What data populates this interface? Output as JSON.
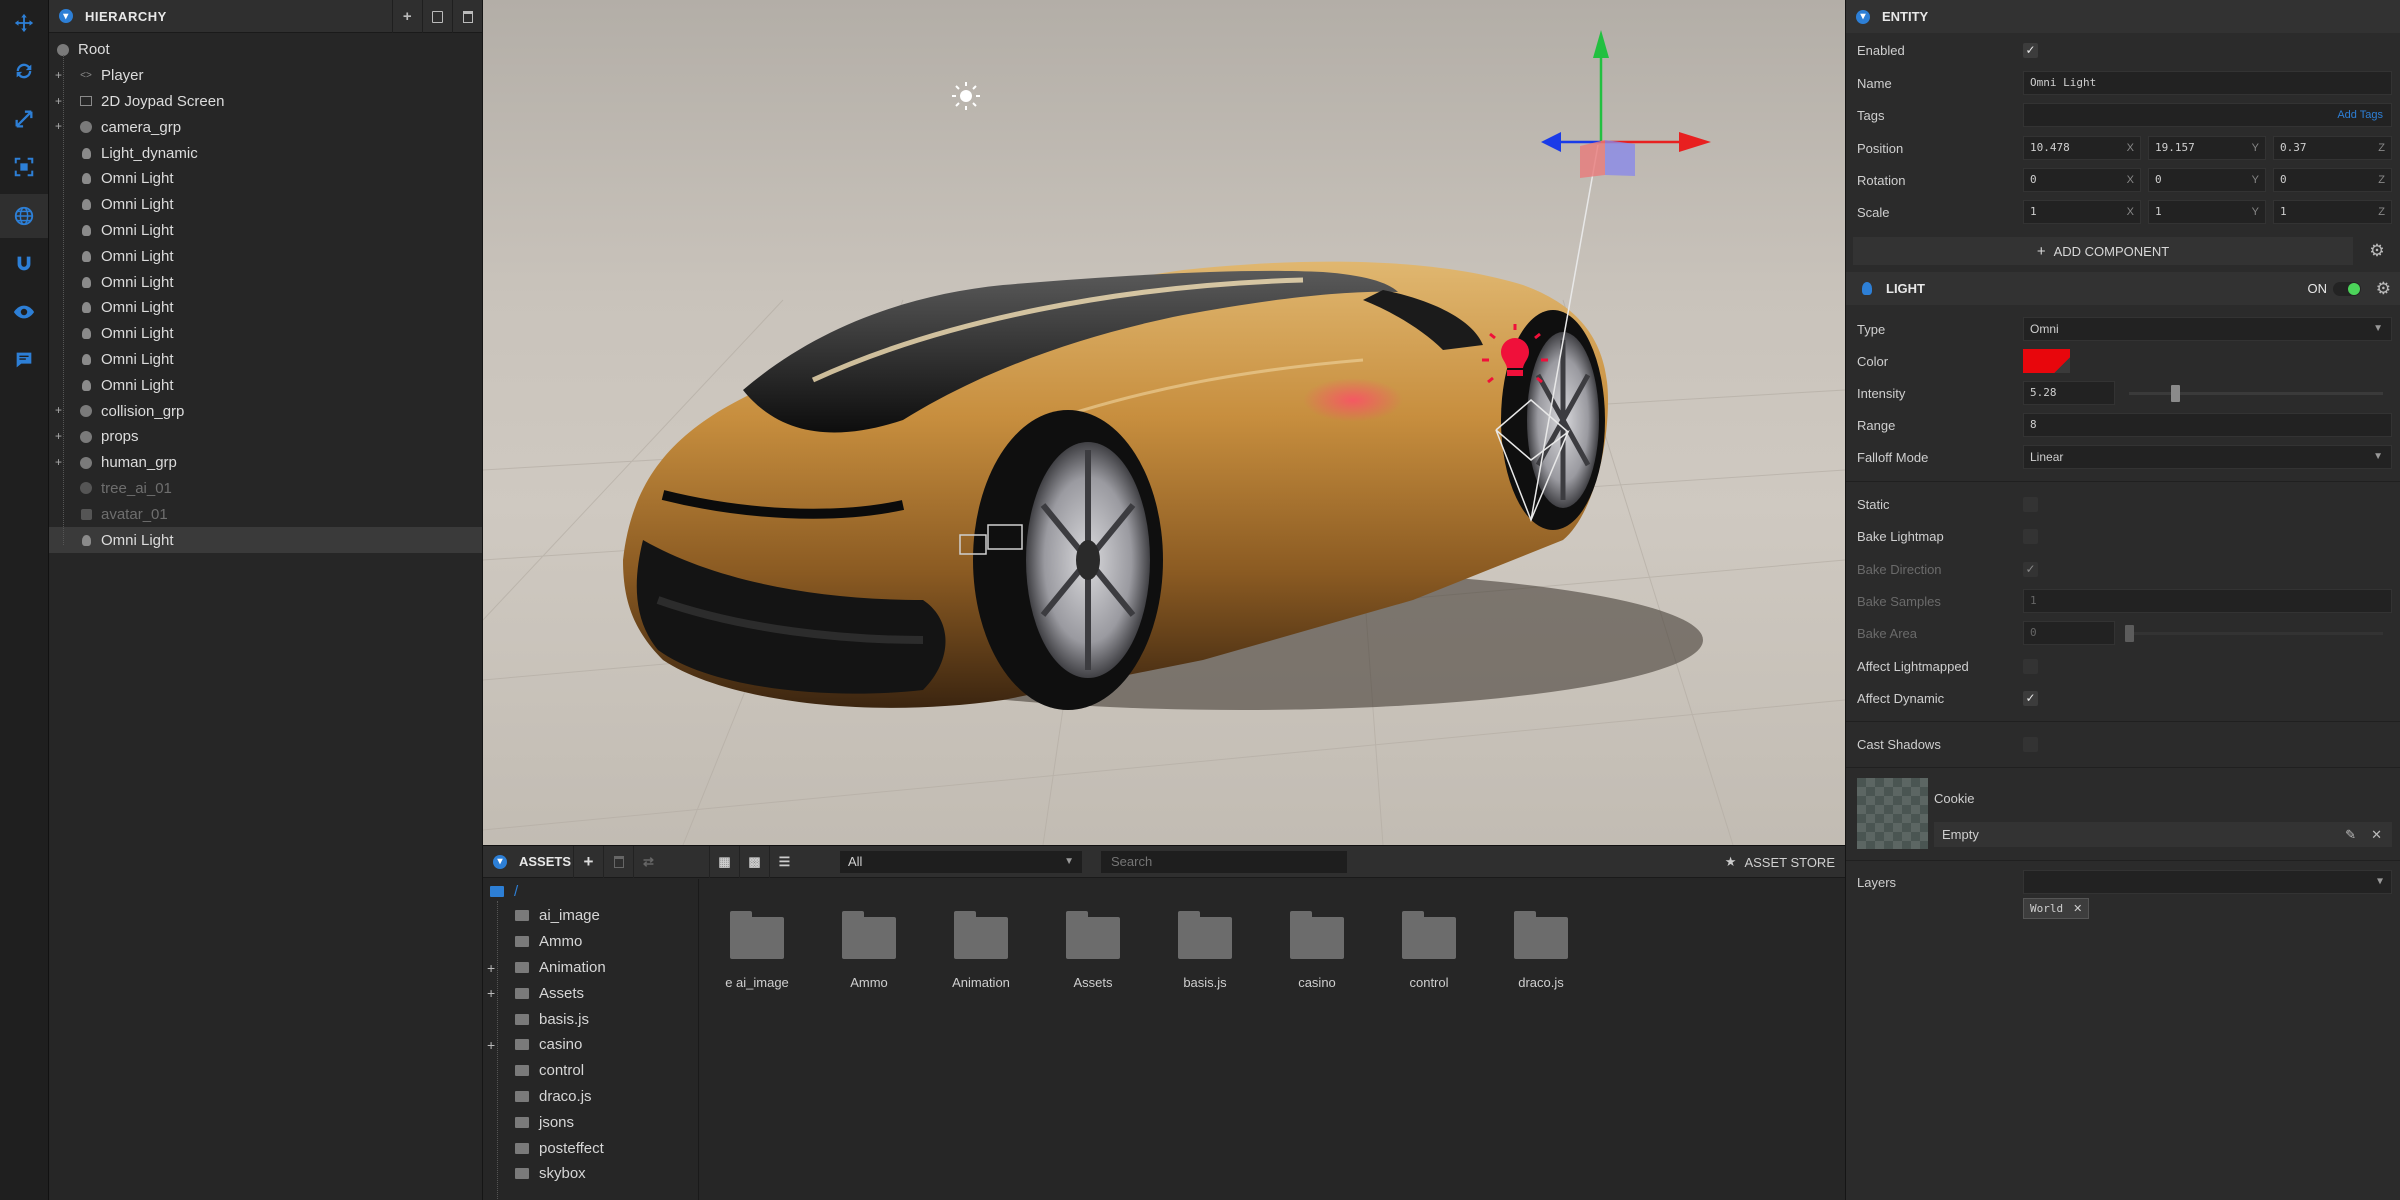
{
  "toolbar": {
    "tools": [
      "move-icon",
      "rotate-icon",
      "scale-icon",
      "resize-icon",
      "world-icon",
      "snap-icon",
      "view-icon",
      "chat-icon"
    ]
  },
  "hierarchy": {
    "title": "HIERARCHY",
    "items": [
      {
        "label": "Root",
        "icon": "circle",
        "depth": 0,
        "expand": false
      },
      {
        "label": "Player",
        "icon": "code",
        "depth": 1,
        "expand": true
      },
      {
        "label": "2D Joypad Screen",
        "icon": "screen",
        "depth": 1,
        "expand": true
      },
      {
        "label": "camera_grp",
        "icon": "circle",
        "depth": 1,
        "expand": true
      },
      {
        "label": "Light_dynamic",
        "icon": "bulb",
        "depth": 1,
        "expand": false
      },
      {
        "label": "Omni Light",
        "icon": "bulb",
        "depth": 1,
        "expand": false
      },
      {
        "label": "Omni Light",
        "icon": "bulb",
        "depth": 1,
        "expand": false
      },
      {
        "label": "Omni Light",
        "icon": "bulb",
        "depth": 1,
        "expand": false
      },
      {
        "label": "Omni Light",
        "icon": "bulb",
        "depth": 1,
        "expand": false
      },
      {
        "label": "Omni Light",
        "icon": "bulb",
        "depth": 1,
        "expand": false
      },
      {
        "label": "Omni Light",
        "icon": "bulb",
        "depth": 1,
        "expand": false
      },
      {
        "label": "Omni Light",
        "icon": "bulb",
        "depth": 1,
        "expand": false
      },
      {
        "label": "Omni Light",
        "icon": "bulb",
        "depth": 1,
        "expand": false
      },
      {
        "label": "Omni Light",
        "icon": "bulb",
        "depth": 1,
        "expand": false
      },
      {
        "label": "collision_grp",
        "icon": "circle",
        "depth": 1,
        "expand": true
      },
      {
        "label": "props",
        "icon": "circle",
        "depth": 1,
        "expand": true
      },
      {
        "label": "human_grp",
        "icon": "circle",
        "depth": 1,
        "expand": true
      },
      {
        "label": "tree_ai_01",
        "icon": "circle",
        "depth": 1,
        "expand": false,
        "dim": true
      },
      {
        "label": "avatar_01",
        "icon": "cube",
        "depth": 1,
        "expand": false,
        "dim": true
      },
      {
        "label": "Omni Light",
        "icon": "bulb",
        "depth": 1,
        "expand": false,
        "selected": true
      }
    ]
  },
  "assets": {
    "title": "ASSETS",
    "filter": "All",
    "search_placeholder": "Search",
    "store_label": "ASSET STORE",
    "root_label": "/",
    "tree": [
      {
        "label": "ai_image",
        "expand": false
      },
      {
        "label": "Ammo",
        "expand": false
      },
      {
        "label": "Animation",
        "expand": true
      },
      {
        "label": "Assets",
        "expand": true
      },
      {
        "label": "basis.js",
        "expand": false
      },
      {
        "label": "casino",
        "expand": true
      },
      {
        "label": "control",
        "expand": false
      },
      {
        "label": "draco.js",
        "expand": false
      },
      {
        "label": "jsons",
        "expand": false
      },
      {
        "label": "posteffect",
        "expand": false
      },
      {
        "label": "skybox",
        "expand": false
      }
    ],
    "grid": [
      "e ai_image",
      "Ammo",
      "Animation",
      "Assets",
      "basis.js",
      "casino",
      "control",
      "draco.js"
    ]
  },
  "entity": {
    "title": "ENTITY",
    "enabled_label": "Enabled",
    "name_label": "Name",
    "name_value": "Omni Light",
    "tags_label": "Tags",
    "add_tags": "Add Tags",
    "position_label": "Position",
    "position": [
      "10.478",
      "19.157",
      "0.37"
    ],
    "rotation_label": "Rotation",
    "rotation": [
      "0",
      "0",
      "0"
    ],
    "scale_label": "Scale",
    "scale": [
      "1",
      "1",
      "1"
    ],
    "add_component": "ADD COMPONENT"
  },
  "light": {
    "title": "LIGHT",
    "on_label": "ON",
    "type_label": "Type",
    "type_value": "Omni",
    "color_label": "Color",
    "color_value": "#e8060c",
    "intensity_label": "Intensity",
    "intensity_value": "5.28",
    "intensity_fraction": 0.17,
    "range_label": "Range",
    "range_value": "8",
    "falloff_label": "Falloff Mode",
    "falloff_value": "Linear",
    "static_label": "Static",
    "bake_lightmap_label": "Bake Lightmap",
    "bake_direction_label": "Bake Direction",
    "bake_samples_label": "Bake Samples",
    "bake_samples_value": "1",
    "bake_area_label": "Bake Area",
    "bake_area_value": "0",
    "affect_lightmapped_label": "Affect Lightmapped",
    "affect_dynamic_label": "Affect Dynamic",
    "cast_shadows_label": "Cast Shadows",
    "cookie_label": "Cookie",
    "cookie_value": "Empty",
    "layers_label": "Layers",
    "layer_tag": "World"
  }
}
